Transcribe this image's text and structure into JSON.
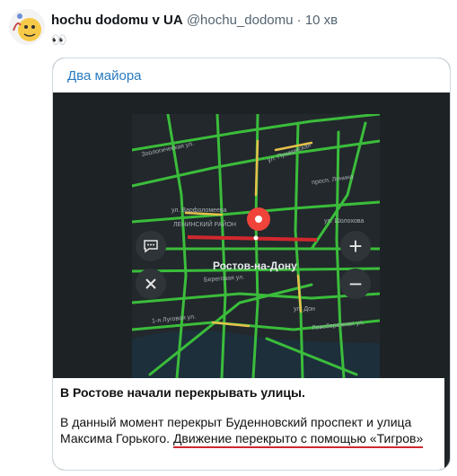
{
  "tweet": {
    "author_name": "hochu dodomu v UA",
    "author_handle": "@hochu_dodomu",
    "separator": "·",
    "time": "10 хв",
    "emoji": "👀"
  },
  "card": {
    "channel": "Два майора",
    "text_title": "В Ростове начали перекрывать улицы.",
    "text_body_plain": "В данный момент перекрыт Буденновский проспект и улица Максима Горького.",
    "text_body_underlined": "Движение перекрыто с помощью «Тигров»"
  },
  "map": {
    "city_label": "Ростов-на-Дону",
    "street_labels": [
      "Зоологическая ул.",
      "ул. Пушкинская",
      "просп. Ленина",
      "ул. Варфоломеева",
      "ЛЕНИНСКИЙ РАЙОН",
      "ул. Шолохова",
      "Береговая ул.",
      "1-я Луговая ул.",
      "ул. Дон",
      "Левобережная ул."
    ],
    "colors": {
      "road": "#3bbd3b",
      "jam": "#e7c14b",
      "blocked": "#d0282e",
      "pin": "#f0433a"
    }
  },
  "controls": {
    "comment_icon": "speech-bubble-icon",
    "close_icon": "close-icon",
    "zoom_in": "+",
    "zoom_out": "−"
  }
}
